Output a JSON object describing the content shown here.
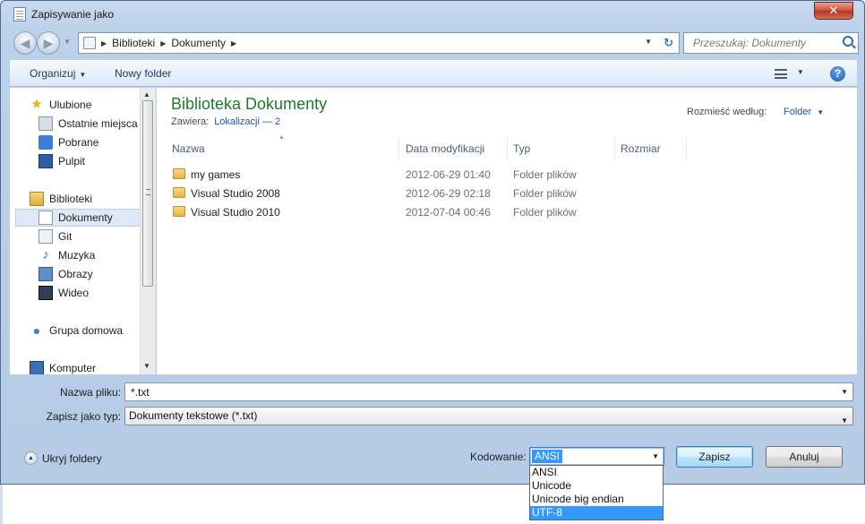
{
  "window": {
    "title": "Zapisywanie jako",
    "close_glyph": "✕"
  },
  "address": {
    "crumbs": [
      "Biblioteki",
      "Dokumenty"
    ],
    "search_placeholder": "Przeszukaj: Dokumenty"
  },
  "toolbar": {
    "organize": "Organizuj",
    "new_folder": "Nowy folder",
    "help_glyph": "?"
  },
  "sidebar": {
    "items": [
      {
        "label": "Ulubione",
        "icon": "star-icon"
      },
      {
        "label": "Ostatnie miejsca",
        "icon": "recent-places-icon"
      },
      {
        "label": "Pobrane",
        "icon": "downloads-icon"
      },
      {
        "label": "Pulpit",
        "icon": "desktop-icon"
      },
      {
        "label": "Biblioteki",
        "icon": "libraries-icon"
      },
      {
        "label": "Dokumenty",
        "icon": "documents-icon"
      },
      {
        "label": "Git",
        "icon": "git-icon"
      },
      {
        "label": "Muzyka",
        "icon": "music-icon"
      },
      {
        "label": "Obrazy",
        "icon": "pictures-icon"
      },
      {
        "label": "Wideo",
        "icon": "video-icon"
      },
      {
        "label": "Grupa domowa",
        "icon": "homegroup-icon"
      },
      {
        "label": "Komputer",
        "icon": "computer-icon"
      }
    ],
    "selected": "Dokumenty"
  },
  "content": {
    "title": "Biblioteka Dokumenty",
    "contains_label": "Zawiera:",
    "contains_link": "Lokalizacji — 2",
    "arrange_label": "Rozmieść według:",
    "arrange_value": "Folder",
    "columns": [
      "Nazwa",
      "Data modyfikacji",
      "Typ",
      "Rozmiar"
    ],
    "files": [
      {
        "name": "my games",
        "date": "2012-06-29 01:40",
        "type": "Folder plików"
      },
      {
        "name": "Visual Studio 2008",
        "date": "2012-06-29 02:18",
        "type": "Folder plików"
      },
      {
        "name": "Visual Studio 2010",
        "date": "2012-07-04 00:46",
        "type": "Folder plików"
      }
    ]
  },
  "form": {
    "filename_label": "Nazwa pliku:",
    "filename_value": "*.txt",
    "type_label": "Zapisz jako typ:",
    "type_value": "Dokumenty tekstowe (*.txt)",
    "hide_folders": "Ukryj foldery",
    "encoding_label": "Kodowanie:",
    "encoding_value": "ANSI",
    "encoding_options": [
      "ANSI",
      "Unicode",
      "Unicode big endian",
      "UTF-8"
    ],
    "encoding_highlighted": "UTF-8",
    "save": "Zapisz",
    "cancel": "Anuluj"
  },
  "colors": {
    "library_title": "#1e7a2e",
    "link": "#1e56b0",
    "selection": "#3399ff"
  }
}
